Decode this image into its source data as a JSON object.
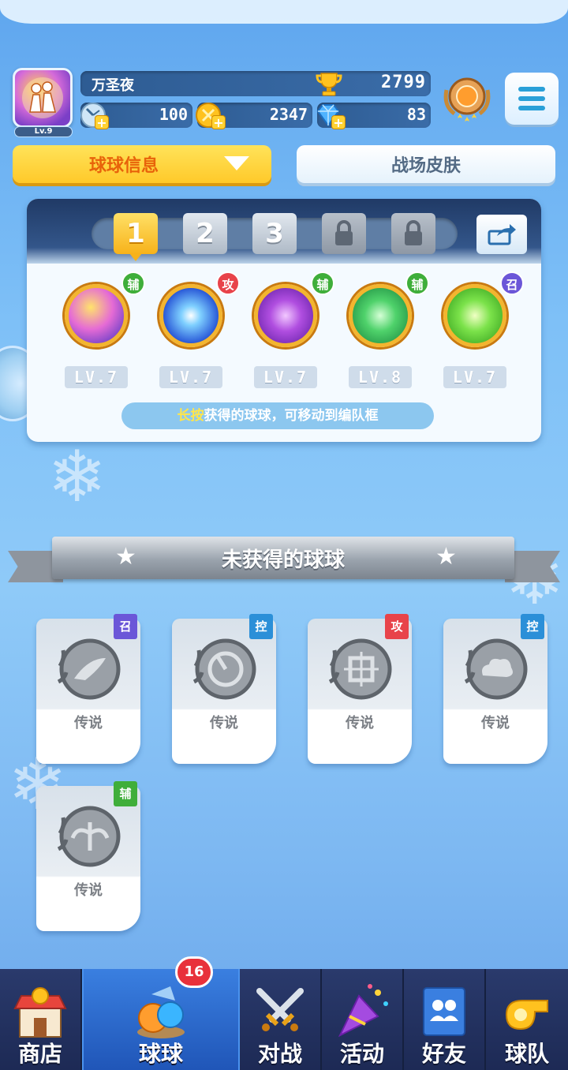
{
  "player": {
    "name": "万圣夜",
    "level_label": "Lv.9",
    "trophies": "2799",
    "stamina": "100",
    "coins": "2347",
    "gems": "83"
  },
  "tabs": [
    {
      "label": "球球信息",
      "active": true
    },
    {
      "label": "战场皮肤",
      "active": false
    }
  ],
  "team": {
    "slots": [
      "1",
      "2",
      "3",
      "lock",
      "lock"
    ],
    "active_slot": "1",
    "balls": [
      {
        "tag": "辅",
        "level": "LV.7",
        "tag_color": "#3fae3a",
        "theme": "rainbow"
      },
      {
        "tag": "攻",
        "level": "LV.7",
        "tag_color": "#e8434a",
        "theme": "swirl"
      },
      {
        "tag": "辅",
        "level": "LV.7",
        "tag_color": "#3fae3a",
        "theme": "butterfly"
      },
      {
        "tag": "辅",
        "level": "LV.8",
        "tag_color": "#3fae3a",
        "theme": "tree"
      },
      {
        "tag": "召",
        "level": "LV.7",
        "tag_color": "#6b56d8",
        "theme": "gear"
      }
    ],
    "hint_highlight": "长按",
    "hint_text": "获得的球球，可移动到编队框"
  },
  "locked_section": {
    "title": "未获得的球球",
    "cards": [
      {
        "tag": "召",
        "rarity": "传说",
        "tag_color": "#6b56d8"
      },
      {
        "tag": "控",
        "rarity": "传说",
        "tag_color": "#2b8fd8"
      },
      {
        "tag": "攻",
        "rarity": "传说",
        "tag_color": "#e8434a"
      },
      {
        "tag": "控",
        "rarity": "传说",
        "tag_color": "#2b8fd8"
      },
      {
        "tag": "辅",
        "rarity": "传说",
        "tag_color": "#3fae3a"
      }
    ]
  },
  "nav": {
    "items": [
      {
        "label": "商店",
        "icon": "shop-icon"
      },
      {
        "label": "球球",
        "icon": "balls-icon",
        "active": true,
        "badge": "16"
      },
      {
        "label": "对战",
        "icon": "swords-icon"
      },
      {
        "label": "活动",
        "icon": "party-popper-icon"
      },
      {
        "label": "好友",
        "icon": "friends-book-icon"
      },
      {
        "label": "球队",
        "icon": "whistle-icon"
      }
    ]
  }
}
